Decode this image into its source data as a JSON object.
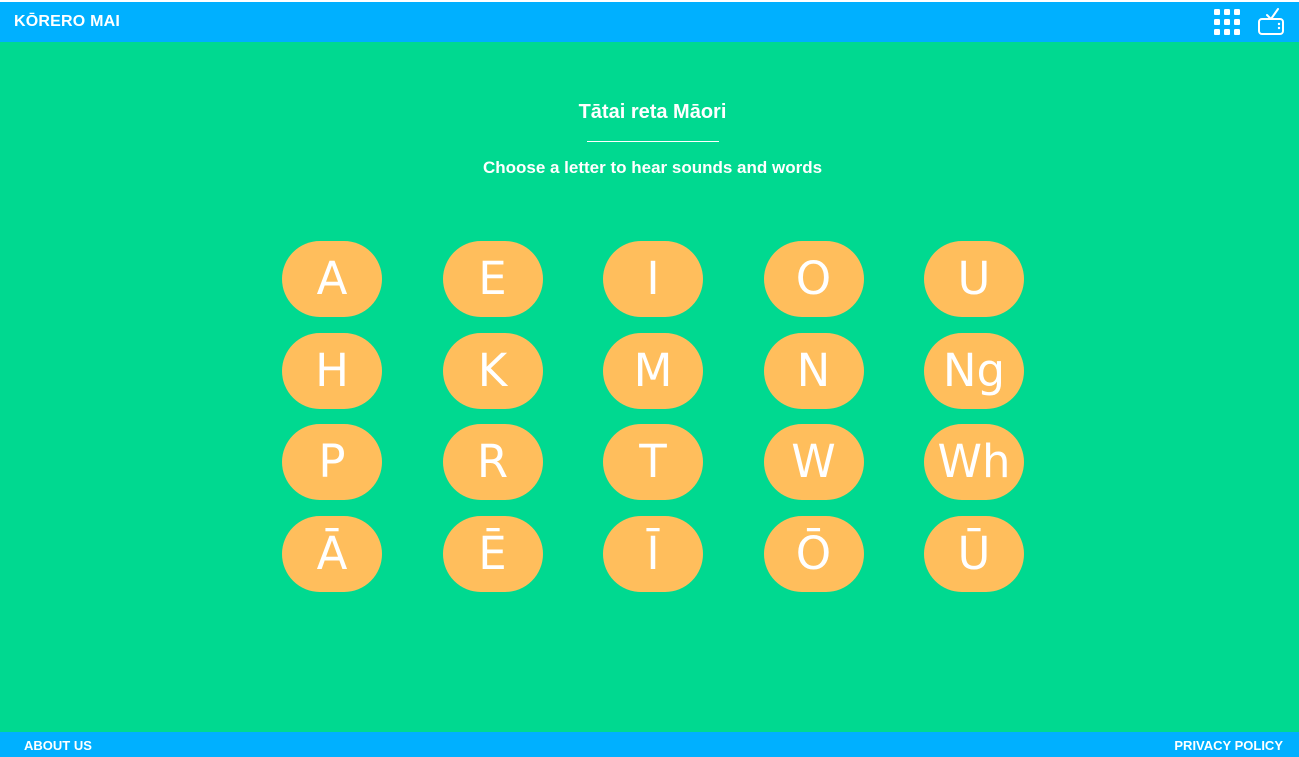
{
  "header": {
    "brand": "KŌRERO MAI",
    "icons": [
      "apps-grid-icon",
      "tv-icon"
    ]
  },
  "main": {
    "title": "Tātai reta Māori",
    "subtitle": "Choose a letter to hear sounds and words",
    "letters": [
      "A",
      "E",
      "I",
      "O",
      "U",
      "H",
      "K",
      "M",
      "N",
      "Ng",
      "P",
      "R",
      "T",
      "W",
      "Wh",
      "Ā",
      "Ē",
      "Ī",
      "Ō",
      "Ū"
    ]
  },
  "footer": {
    "about": "ABOUT US",
    "privacy": "PRIVACY POLICY"
  },
  "colors": {
    "header_bg": "#00b0ff",
    "main_bg": "#00d990",
    "letter_bg": "#ffbe5c",
    "text": "#ffffff"
  }
}
